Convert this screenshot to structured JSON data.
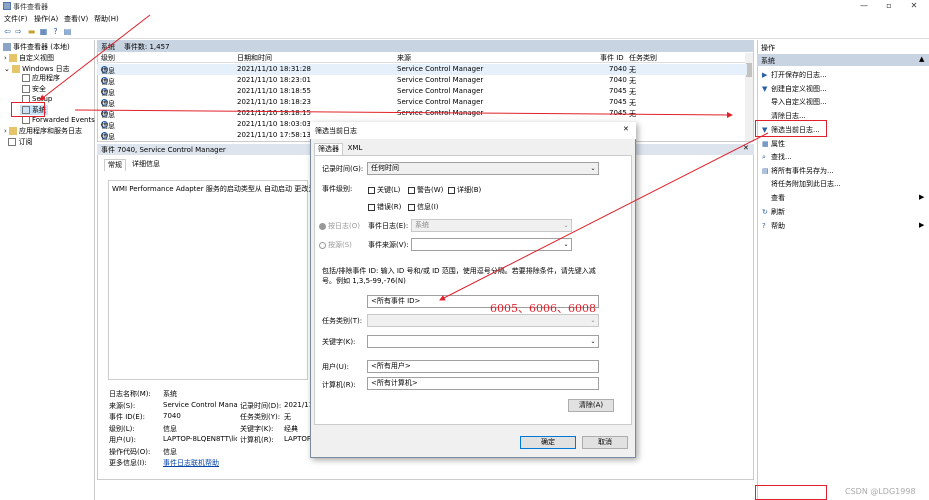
{
  "window": {
    "title": "事件查看器"
  },
  "menu": [
    "文件(F)",
    "操作(A)",
    "查看(V)",
    "帮助(H)"
  ],
  "tree": {
    "root": "事件查看器 (本地)",
    "custom_views": "自定义视图",
    "windows_logs": "Windows 日志",
    "app": "应用程序",
    "security": "安全",
    "setup": "Setup",
    "system": "系统",
    "forwarded": "Forwarded Events",
    "apps_services": "应用程序和服务日志",
    "subscriptions": "订阅"
  },
  "list": {
    "header": "系统    事件数: 1,457",
    "columns": [
      "级别",
      "日期和时间",
      "来源",
      "事件 ID",
      "任务类别"
    ],
    "rows": [
      {
        "level": "信息",
        "time": "2021/11/10 18:31:28",
        "source": "Service Control Manager",
        "id": "7040",
        "cat": "无"
      },
      {
        "level": "信息",
        "time": "2021/11/10 18:23:01",
        "source": "Service Control Manager",
        "id": "7040",
        "cat": "无"
      },
      {
        "level": "信息",
        "time": "2021/11/10 18:18:55",
        "source": "Service Control Manager",
        "id": "7045",
        "cat": "无"
      },
      {
        "level": "信息",
        "time": "2021/11/10 18:18:23",
        "source": "Service Control Manager",
        "id": "7045",
        "cat": "无"
      },
      {
        "level": "信息",
        "time": "2021/11/10 18:18:15",
        "source": "Service Control Manager",
        "id": "7045",
        "cat": "无"
      },
      {
        "level": "信息",
        "time": "2021/11/10 18:03:03",
        "source": "",
        "id": "",
        "cat": ""
      },
      {
        "level": "信息",
        "time": "2021/11/10 17:58:13",
        "source": "",
        "id": "",
        "cat": ""
      }
    ]
  },
  "detail": {
    "header": "事件 7040, Service Control Manager",
    "tabs": [
      "常规",
      "详细信息"
    ],
    "message": "WMI Performance Adapter 服务的启动类型从 自动启动 更改为 按",
    "props_left": [
      {
        "k": "日志名称(M):",
        "v": "系统"
      },
      {
        "k": "来源(S):",
        "v": "Service Control Manag"
      },
      {
        "k": "事件 ID(E):",
        "v": "7040"
      },
      {
        "k": "级别(L):",
        "v": "信息"
      },
      {
        "k": "用户(U):",
        "v": "LAPTOP-8LQEN8TT\\lic"
      },
      {
        "k": "操作代码(O):",
        "v": "信息"
      },
      {
        "k": "更多信息(I):",
        "v": "事件日志联机帮助"
      }
    ],
    "props_mid": [
      {
        "k": "记录时间(D):",
        "v": "2021/11"
      },
      {
        "k": "任务类别(Y):",
        "v": "无"
      },
      {
        "k": "关键字(K):",
        "v": "经典"
      },
      {
        "k": "计算机(R):",
        "v": "LAPTOP"
      }
    ]
  },
  "actions": {
    "title": "操作",
    "section": "系统",
    "items": [
      "打开保存的日志...",
      "创建自定义视图...",
      "导入自定义视图...",
      "清除日志...",
      "筛选当前日志...",
      "属性",
      "查找...",
      "将所有事件另存为...",
      "将任务附加到此日志...",
      "查看",
      "刷新",
      "帮助"
    ],
    "icons": [
      "▶",
      "▼",
      "",
      "",
      "▼",
      "▦",
      "⌕",
      "▤",
      "",
      "",
      "↻",
      "?"
    ]
  },
  "dialog": {
    "title": "筛选当前日志",
    "tabs": [
      "筛选器",
      "XML"
    ],
    "logged_label": "记录时间(G):",
    "logged_value": "任何时间",
    "level_label": "事件级别:",
    "levels": [
      "关键(L)",
      "警告(W)",
      "详细(B)",
      "错误(R)",
      "信息(I)"
    ],
    "by_log": "按日志(O)",
    "event_log_label": "事件日志(E):",
    "event_log_value": "系统",
    "by_source": "按源(S)",
    "event_source_label": "事件来源(V):",
    "include_text": "包括/排除事件 ID: 输入 ID 号和/或 ID 范围，使用逗号分隔。若要排除条件，请先键入减号。例如 1,3,5-99,-76(N)",
    "event_id_value": "<所有事件 ID>",
    "task_label": "任务类别(T):",
    "keyword_label": "关键字(K):",
    "user_label": "用户(U):",
    "user_value": "<所有用户>",
    "computer_label": "计算机(R):",
    "computer_value": "<所有计算机>",
    "clear": "清除(A)",
    "ok": "确定",
    "cancel": "取消"
  },
  "annotation": {
    "text": "6005、6006、6008",
    "color": "#e0202a"
  },
  "watermark": "CSDN @LDG1998"
}
